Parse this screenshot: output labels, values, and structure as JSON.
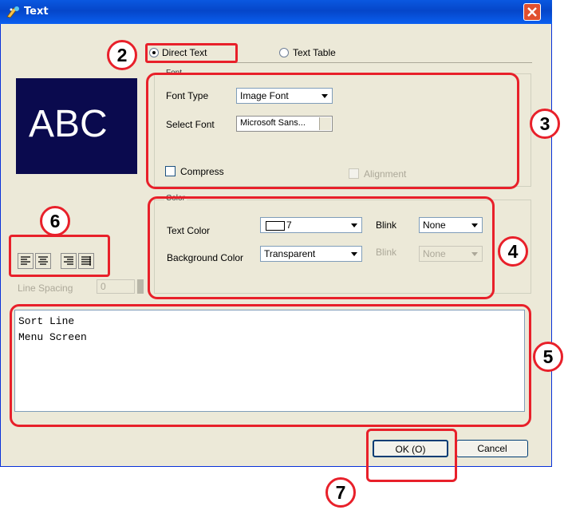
{
  "window": {
    "title": "Text"
  },
  "mode": {
    "direct_text": "Direct Text",
    "text_table": "Text Table"
  },
  "preview": {
    "text": "ABC"
  },
  "font": {
    "group_label": "Font",
    "type_label": "Font Type",
    "type_value": "Image Font",
    "select_label": "Select Font",
    "select_value": "Microsoft  Sans...",
    "compress_label": "Compress",
    "alignment_label": "Alignment"
  },
  "color": {
    "group_label": "Color",
    "text_color_label": "Text Color",
    "text_color_value": "7",
    "background_label": "Background Color",
    "background_value": "Transparent",
    "blink_label_1": "Blink",
    "blink_value_1": "None",
    "blink_label_2": "Blink",
    "blink_value_2": "None"
  },
  "line_spacing": {
    "label": "Line Spacing",
    "value": "0"
  },
  "text_lines": [
    "Sort Line",
    "Menu Screen"
  ],
  "buttons": {
    "ok": "OK (O)",
    "cancel": "Cancel"
  },
  "callouts": [
    "2",
    "3",
    "4",
    "5",
    "6",
    "7"
  ],
  "colors": {
    "accent_red": "#e8202a",
    "preview_bg": "#0a0a4e",
    "title_blue": "#0546c9"
  },
  "icons": [
    "app-icon",
    "close-icon",
    "align-left-icon",
    "align-center-icon",
    "align-right-icon",
    "align-justify-icon"
  ]
}
